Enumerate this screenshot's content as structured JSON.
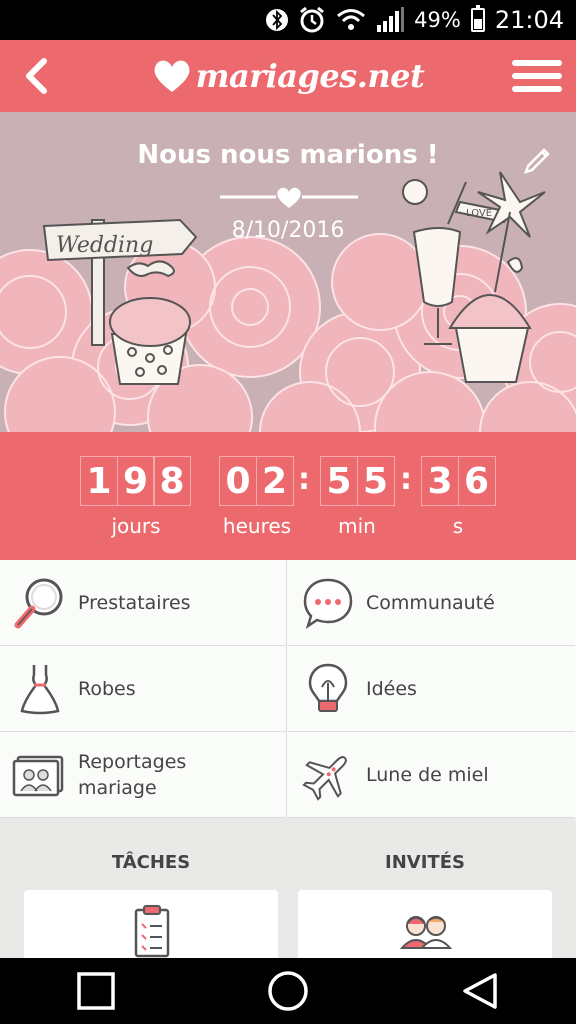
{
  "status_bar": {
    "battery_percent": "49%",
    "time": "21:04",
    "icons": [
      "bluetooth-icon",
      "alarm-icon",
      "wifi-icon",
      "signal-icon",
      "battery-icon"
    ]
  },
  "header": {
    "logo_text": "mariages.net",
    "back_icon": "chevron-left-icon",
    "menu_icon": "hamburger-icon"
  },
  "hero": {
    "title": "Nous nous marions !",
    "date": "8/10/2016",
    "sign_text": "Wedding",
    "flag_text": "LOVE"
  },
  "countdown": {
    "days": [
      "1",
      "9",
      "8"
    ],
    "hours": [
      "0",
      "2"
    ],
    "minutes": [
      "5",
      "5"
    ],
    "seconds": [
      "3",
      "6"
    ],
    "labels": {
      "days": "jours",
      "hours": "heures",
      "minutes": "min",
      "seconds": "s"
    }
  },
  "menu": {
    "items": [
      {
        "label": "Prestataires",
        "icon": "magnifier-icon"
      },
      {
        "label": "Communauté",
        "icon": "speech-bubble-icon"
      },
      {
        "label": "Robes",
        "icon": "dress-icon"
      },
      {
        "label": "Idées",
        "icon": "lightbulb-icon"
      },
      {
        "label": "Reportages\nmariage",
        "icon": "photo-album-icon"
      },
      {
        "label": "Lune de miel",
        "icon": "airplane-icon"
      }
    ]
  },
  "sections": {
    "tasks_title": "TÂCHES",
    "guests_title": "INVITÉS"
  },
  "colors": {
    "brand": "#ec6a6e",
    "hero_bg": "#c9b0b4",
    "flowers": "#f2b6bd"
  }
}
